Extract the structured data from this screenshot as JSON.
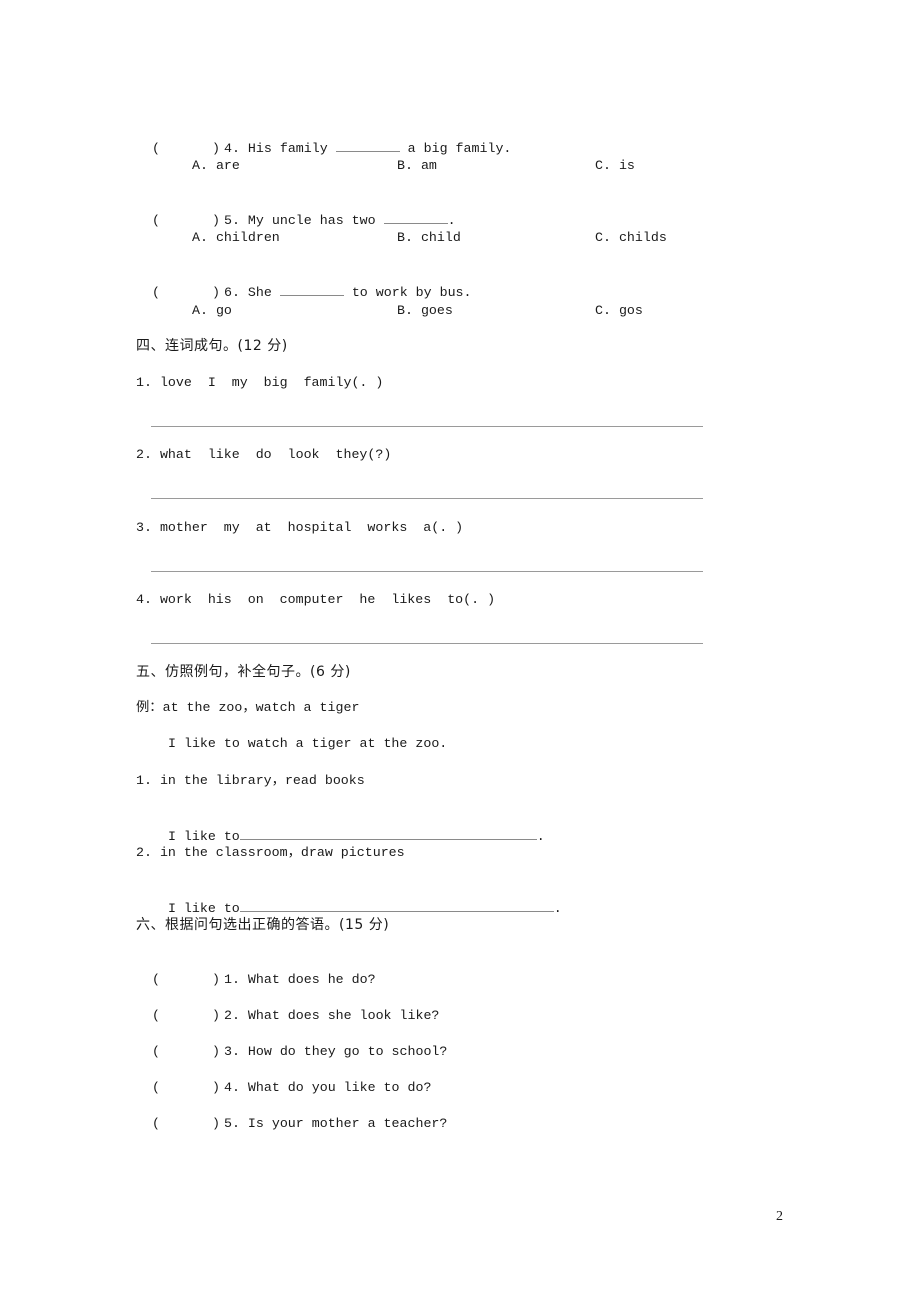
{
  "section3_choice": {
    "questions": [
      {
        "paren": "(",
        "paren_close": ")",
        "number": "4.",
        "before": "His family ",
        "after": " a big family.",
        "options": [
          "A. are",
          "B. am",
          "C. is"
        ]
      },
      {
        "paren": "(",
        "paren_close": ")",
        "number": "5.",
        "before": "My uncle has two ",
        "after": ".",
        "options": [
          "A. children",
          "B. child",
          "C. childs"
        ]
      },
      {
        "paren": "(",
        "paren_close": ")",
        "number": "6.",
        "before": "She ",
        "after": " to work by bus.",
        "options": [
          "A. go",
          "B. goes",
          "C. gos"
        ]
      }
    ]
  },
  "section4": {
    "heading": "四、连词成句。(12 分)",
    "items": [
      "1. love  I  my  big  family(. )",
      "2. what  like  do  look  they(?)",
      "3. mother  my  at  hospital  works  a(. )",
      "4. work  his  on  computer  he  likes  to(. )"
    ]
  },
  "section5": {
    "heading": "五、仿照例句，补全句子。(6 分)",
    "example_prompt": "例：at the zoo，watch a tiger",
    "example_answer": "I like to watch a tiger at the zoo.",
    "items": [
      {
        "prompt": "1. in the library，read books",
        "answer_prefix": "I like to",
        "answer_suffix": "."
      },
      {
        "prompt": "2. in the classroom，draw pictures",
        "answer_prefix": "I like to",
        "answer_suffix": "."
      }
    ]
  },
  "section6": {
    "heading": "六、根据问句选出正确的答语。(15 分)",
    "questions": [
      {
        "paren": "(",
        "paren_close": ")",
        "text": "1. What does he do?"
      },
      {
        "paren": "(",
        "paren_close": ")",
        "text": "2. What does she look like?"
      },
      {
        "paren": "(",
        "paren_close": ")",
        "text": "3. How do they go to school?"
      },
      {
        "paren": "(",
        "paren_close": ")",
        "text": "4. What do you like to do?"
      },
      {
        "paren": "(",
        "paren_close": ")",
        "text": "5. Is your mother a teacher?"
      }
    ]
  },
  "page_number": "2"
}
